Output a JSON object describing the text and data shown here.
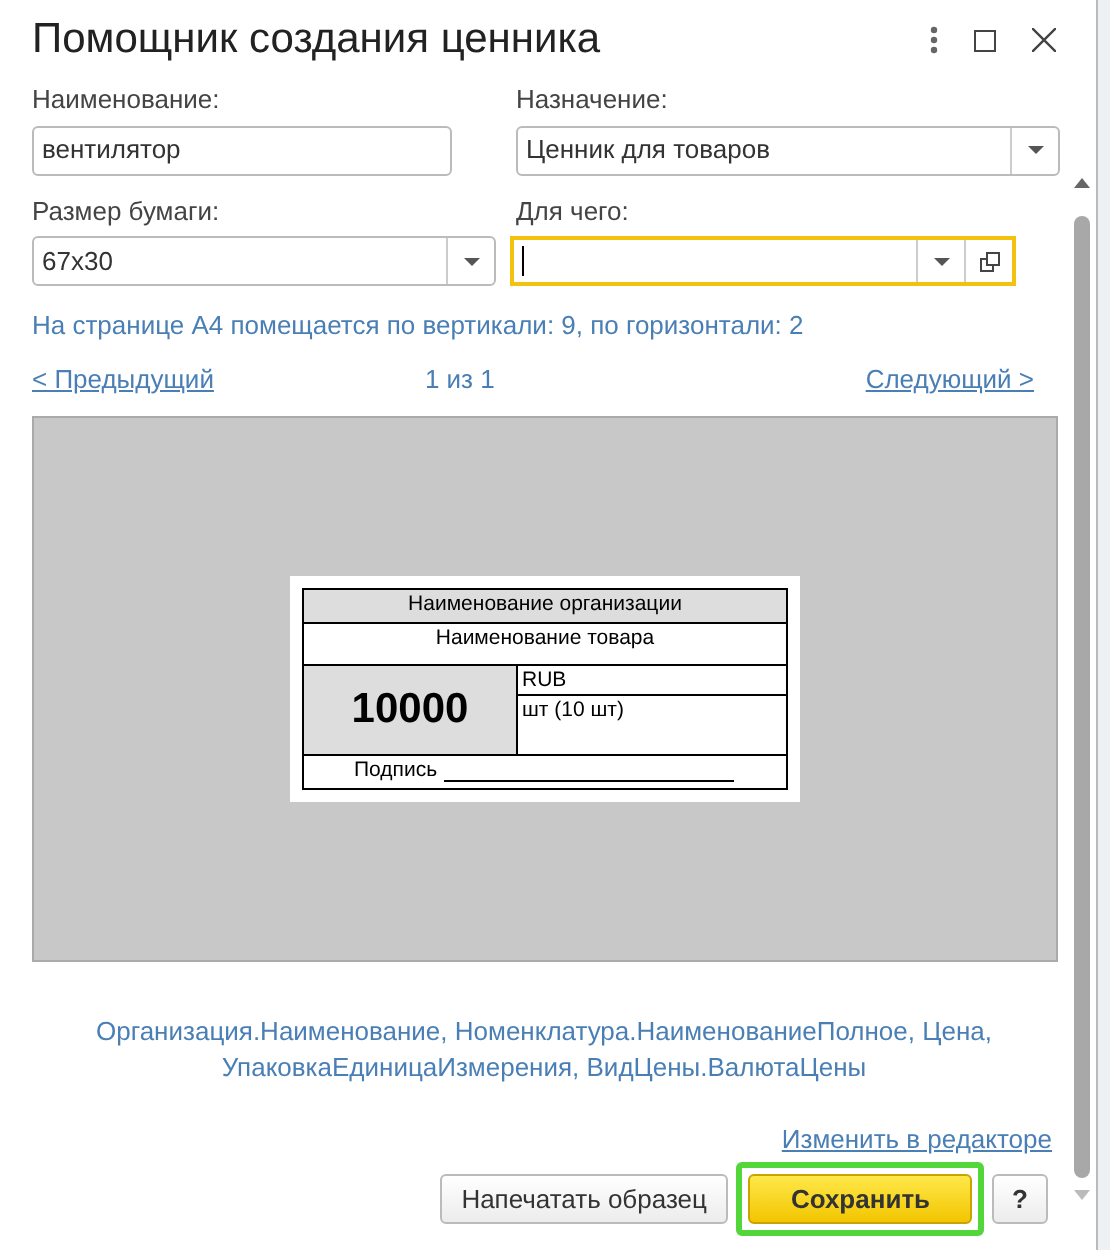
{
  "window": {
    "title": "Помощник создания ценника"
  },
  "fields": [
    {
      "label": "Наименование:",
      "value": "вентилятор",
      "kind": "text",
      "focused": false
    },
    {
      "label": "Назначение:",
      "value": "Ценник для товаров",
      "kind": "dropdown",
      "focused": false
    },
    {
      "label": "Размер бумаги:",
      "value": "67x30",
      "kind": "dropdown",
      "focused": false
    },
    {
      "label": "Для чего:",
      "kind": "choice",
      "focused": true
    }
  ],
  "page_info": "На странице А4 помещается по вертикали: 9, по горизонтали: 2",
  "pager": {
    "previous": "< Предыдущий",
    "position": "1 из 1",
    "next": "Следующий >"
  },
  "price_tag": {
    "organization": "Наименование организации",
    "product": "Наименование товара",
    "price": "10000",
    "currency": "RUB",
    "unit": "шт (10 шт)",
    "signature": "Подпись"
  },
  "template_fields": "Организация.Наименование, Номенклатура.НаименованиеПолное, Цена, УпаковкаЕдиницаИзмерения, ВидЦены.ВалютаЦены",
  "edit_link": "Изменить в редакторе",
  "buttons": [
    {
      "label": "Напечатать образец",
      "kind": "default",
      "focused": false
    },
    {
      "label": "Сохранить",
      "kind": "primary",
      "focused": true
    },
    {
      "label": "?",
      "kind": "default",
      "focused": false
    }
  ]
}
